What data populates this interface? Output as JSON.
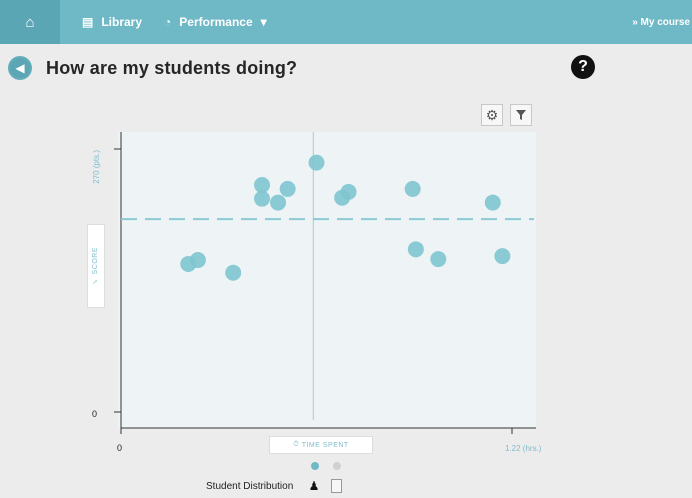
{
  "topbar": {
    "home_icon": "home-icon",
    "library_label": "Library",
    "library_icon": "document-icon",
    "performance_label": "Performance",
    "performance_icon": "pie-chart-icon",
    "performance_caret": "▾",
    "courses_label": "» My course"
  },
  "header": {
    "title": "How are my students doing?",
    "help_symbol": "?"
  },
  "toolbar": {
    "gear_icon": "gear-icon",
    "filter_icon": "filter-icon"
  },
  "chart_data": {
    "type": "scatter",
    "xlabel": "TIME SPENT",
    "ylabel": "SCORE",
    "x_tick_labels": [
      "0",
      "1.22 (hrs.)"
    ],
    "y_tick_labels": [
      "0",
      "270 (pts.)"
    ],
    "xlim": [
      0,
      1.22
    ],
    "ylim": [
      0,
      270
    ],
    "average_score": 198,
    "median_time_spent": 0.6,
    "points": [
      {
        "x": 0.21,
        "y": 152
      },
      {
        "x": 0.24,
        "y": 156
      },
      {
        "x": 0.35,
        "y": 143
      },
      {
        "x": 0.44,
        "y": 233
      },
      {
        "x": 0.44,
        "y": 219
      },
      {
        "x": 0.49,
        "y": 215
      },
      {
        "x": 0.52,
        "y": 229
      },
      {
        "x": 0.61,
        "y": 256
      },
      {
        "x": 0.69,
        "y": 220
      },
      {
        "x": 0.71,
        "y": 226
      },
      {
        "x": 0.91,
        "y": 229
      },
      {
        "x": 0.92,
        "y": 167
      },
      {
        "x": 0.99,
        "y": 157
      },
      {
        "x": 1.16,
        "y": 215
      },
      {
        "x": 1.19,
        "y": 160
      }
    ],
    "grid": false,
    "legend": "none",
    "point_color": "#7ec5d0",
    "avg_line_color": "#8cc9d6"
  },
  "footer": {
    "distribution_label": "Student Distribution",
    "person_icon": "person-icon",
    "document_icon": "document-icon",
    "pager_count": 2,
    "pager_active": 1
  },
  "colors": {
    "brand": "#6fb8c6",
    "brand_dark": "#5aa6b5",
    "background": "#ececec",
    "chart_bg": "#eef4f5"
  }
}
